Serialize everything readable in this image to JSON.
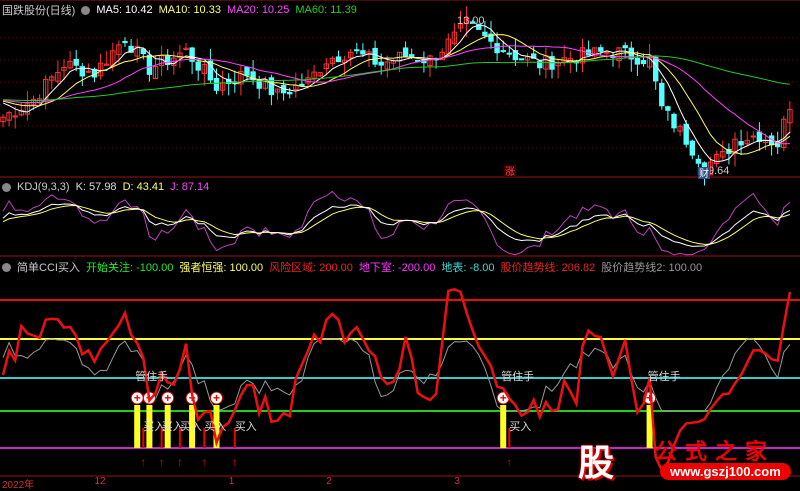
{
  "header": {
    "title": "国跌股份(日线)",
    "ma5": "MA5: 10.42",
    "ma10": "MA10: 10.33",
    "ma20": "MA20: 10.25",
    "ma60": "MA60: 11.39"
  },
  "kdj": {
    "title": "KDJ(9,3,3)",
    "k": "K: 57.98",
    "d": "D: 43.41",
    "j": "J: 87.14"
  },
  "cci": {
    "title": "简单CCI买入",
    "a": "开始关注: -100.00",
    "b": "强者恒强: 100.00",
    "c": "风险区域: 200.00",
    "d": "地下室: -200.00",
    "e": "地表: -8.00",
    "f": "股价趋势线: 206.82",
    "g": "股价趋势线2: 100.00"
  },
  "labels": {
    "high": "13.00",
    "low": "9.64",
    "zhang": "涨",
    "cai": "财",
    "hold": "管住手",
    "buy": "买入",
    "arrow": "↑"
  },
  "axis": [
    "2022年",
    "12",
    "1",
    "2",
    "3"
  ],
  "logo": {
    "gu": "股",
    "site": "公式之家",
    "url": "www.gszj100.com"
  },
  "colors": {
    "up": "#ff3232",
    "down": "#54ffff",
    "ma5": "#ffffff",
    "ma10": "#ffff66",
    "ma20": "#ff40ff",
    "ma60": "#22cc22"
  },
  "chart_data": {
    "type": "candlestick",
    "close_keypoints": [
      [
        0,
        10.8
      ],
      [
        5,
        11.2
      ],
      [
        10,
        12.0
      ],
      [
        15,
        11.8
      ],
      [
        20,
        12.6
      ],
      [
        24,
        11.9
      ],
      [
        30,
        12.3
      ],
      [
        35,
        11.5
      ],
      [
        40,
        11.8
      ],
      [
        45,
        11.3
      ],
      [
        50,
        11.6
      ],
      [
        53,
        12.1
      ],
      [
        57,
        12.3
      ],
      [
        62,
        12.0
      ],
      [
        66,
        12.2
      ],
      [
        70,
        12.1
      ],
      [
        74,
        12.6
      ],
      [
        76,
        12.9
      ],
      [
        80,
        12.5
      ],
      [
        84,
        12.2
      ],
      [
        88,
        12.0
      ],
      [
        95,
        12.2
      ],
      [
        100,
        12.3
      ],
      [
        106,
        12.1
      ],
      [
        108,
        11.0
      ],
      [
        112,
        10.3
      ],
      [
        115,
        9.7
      ],
      [
        118,
        9.9
      ],
      [
        120,
        10.3
      ],
      [
        124,
        10.4
      ],
      [
        127,
        10.2
      ],
      [
        129,
        11.1
      ]
    ],
    "price_range": [
      9.6,
      13.0
    ],
    "cci_levels": [
      200,
      100,
      -8,
      -100,
      -200
    ],
    "signal_bars": [
      22,
      24,
      27,
      31,
      35,
      82,
      106
    ],
    "buy_bars": [
      23,
      26,
      29,
      33,
      38,
      83
    ],
    "hold_bars": [
      22,
      82,
      106
    ],
    "axis_bars": [
      0,
      15,
      37,
      53,
      74
    ]
  }
}
